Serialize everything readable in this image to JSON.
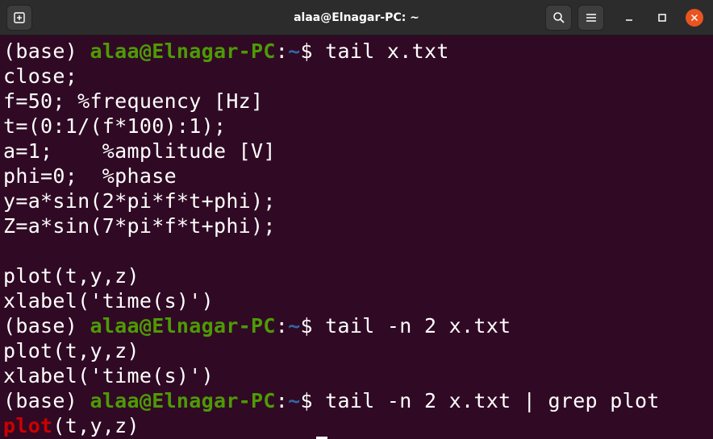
{
  "window": {
    "title": "alaa@Elnagar-PC: ~",
    "icons": {
      "new_tab": "new-tab-icon",
      "search": "search-icon",
      "menu": "hamburger-menu-icon",
      "minimize": "minimize-icon",
      "maximize": "maximize-icon",
      "close": "close-icon"
    }
  },
  "colors": {
    "background": "#300a24",
    "user_host": "#4e9a06",
    "path": "#3465a4",
    "grep_match": "#cc0000",
    "text": "#ffffff",
    "close_button": "#e95420"
  },
  "prompt": {
    "env": "(base) ",
    "user_host": "alaa@Elnagar-PC",
    "sep": ":",
    "path": "~",
    "symbol": "$ "
  },
  "commands": {
    "c1": "tail x.txt",
    "c2": "tail -n 2 x.txt",
    "c3": "tail -n 2 x.txt | grep plot"
  },
  "output1": [
    "close;",
    "f=50; %frequency [Hz]",
    "t=(0:1/(f*100):1);",
    "a=1;    %amplitude [V]",
    "phi=0;  %phase",
    "y=a*sin(2*pi*f*t+phi);",
    "Z=a*sin(7*pi*f*t+phi);",
    "",
    "plot(t,y,z)",
    "xlabel('time(s)')"
  ],
  "output2": [
    "plot(t,y,z)",
    "xlabel('time(s)')"
  ],
  "output3": {
    "match": "plot",
    "rest": "(t,y,z)"
  }
}
